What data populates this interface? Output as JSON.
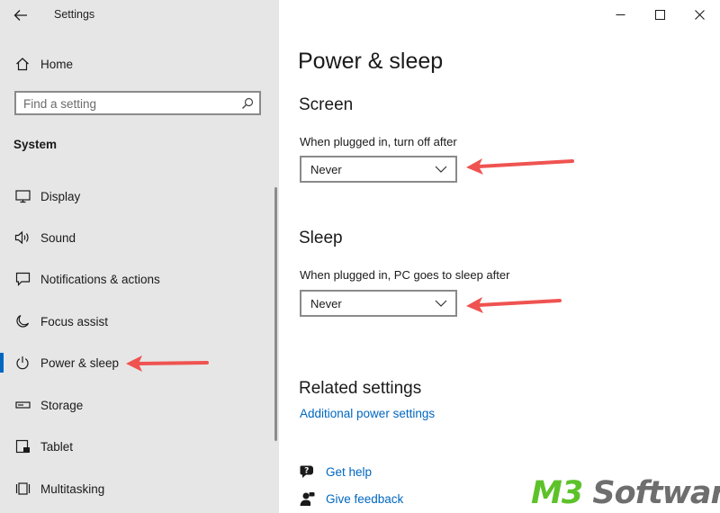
{
  "window": {
    "title": "Settings",
    "controls": [
      "minimize-icon",
      "maximize-icon",
      "close-icon"
    ]
  },
  "sidebar": {
    "home_label": "Home",
    "search_placeholder": "Find a setting",
    "section_header": "System",
    "items": [
      {
        "label": "Display",
        "icon": "display-icon"
      },
      {
        "label": "Sound",
        "icon": "sound-icon"
      },
      {
        "label": "Notifications & actions",
        "icon": "notifications-icon"
      },
      {
        "label": "Focus assist",
        "icon": "focus-assist-icon"
      },
      {
        "label": "Power & sleep",
        "icon": "power-icon",
        "selected": true
      },
      {
        "label": "Storage",
        "icon": "storage-icon"
      },
      {
        "label": "Tablet",
        "icon": "tablet-icon"
      },
      {
        "label": "Multitasking",
        "icon": "multitasking-icon"
      }
    ]
  },
  "main": {
    "page_title": "Power & sleep",
    "screen": {
      "heading": "Screen",
      "label": "When plugged in, turn off after",
      "value": "Never"
    },
    "sleep": {
      "heading": "Sleep",
      "label": "When plugged in, PC goes to sleep after",
      "value": "Never"
    },
    "related": {
      "heading": "Related settings",
      "link": "Additional power settings"
    },
    "help": {
      "get_help": "Get help",
      "give_feedback": "Give feedback"
    }
  },
  "watermark": {
    "part1": "M3",
    "part2": " Software"
  },
  "colors": {
    "sidebar_bg": "#e6e6e6",
    "accent": "#0067c0",
    "annotation_arrow": "#ef5350",
    "watermark_green": "#5dc22a",
    "watermark_gray": "#6e6e6e"
  }
}
